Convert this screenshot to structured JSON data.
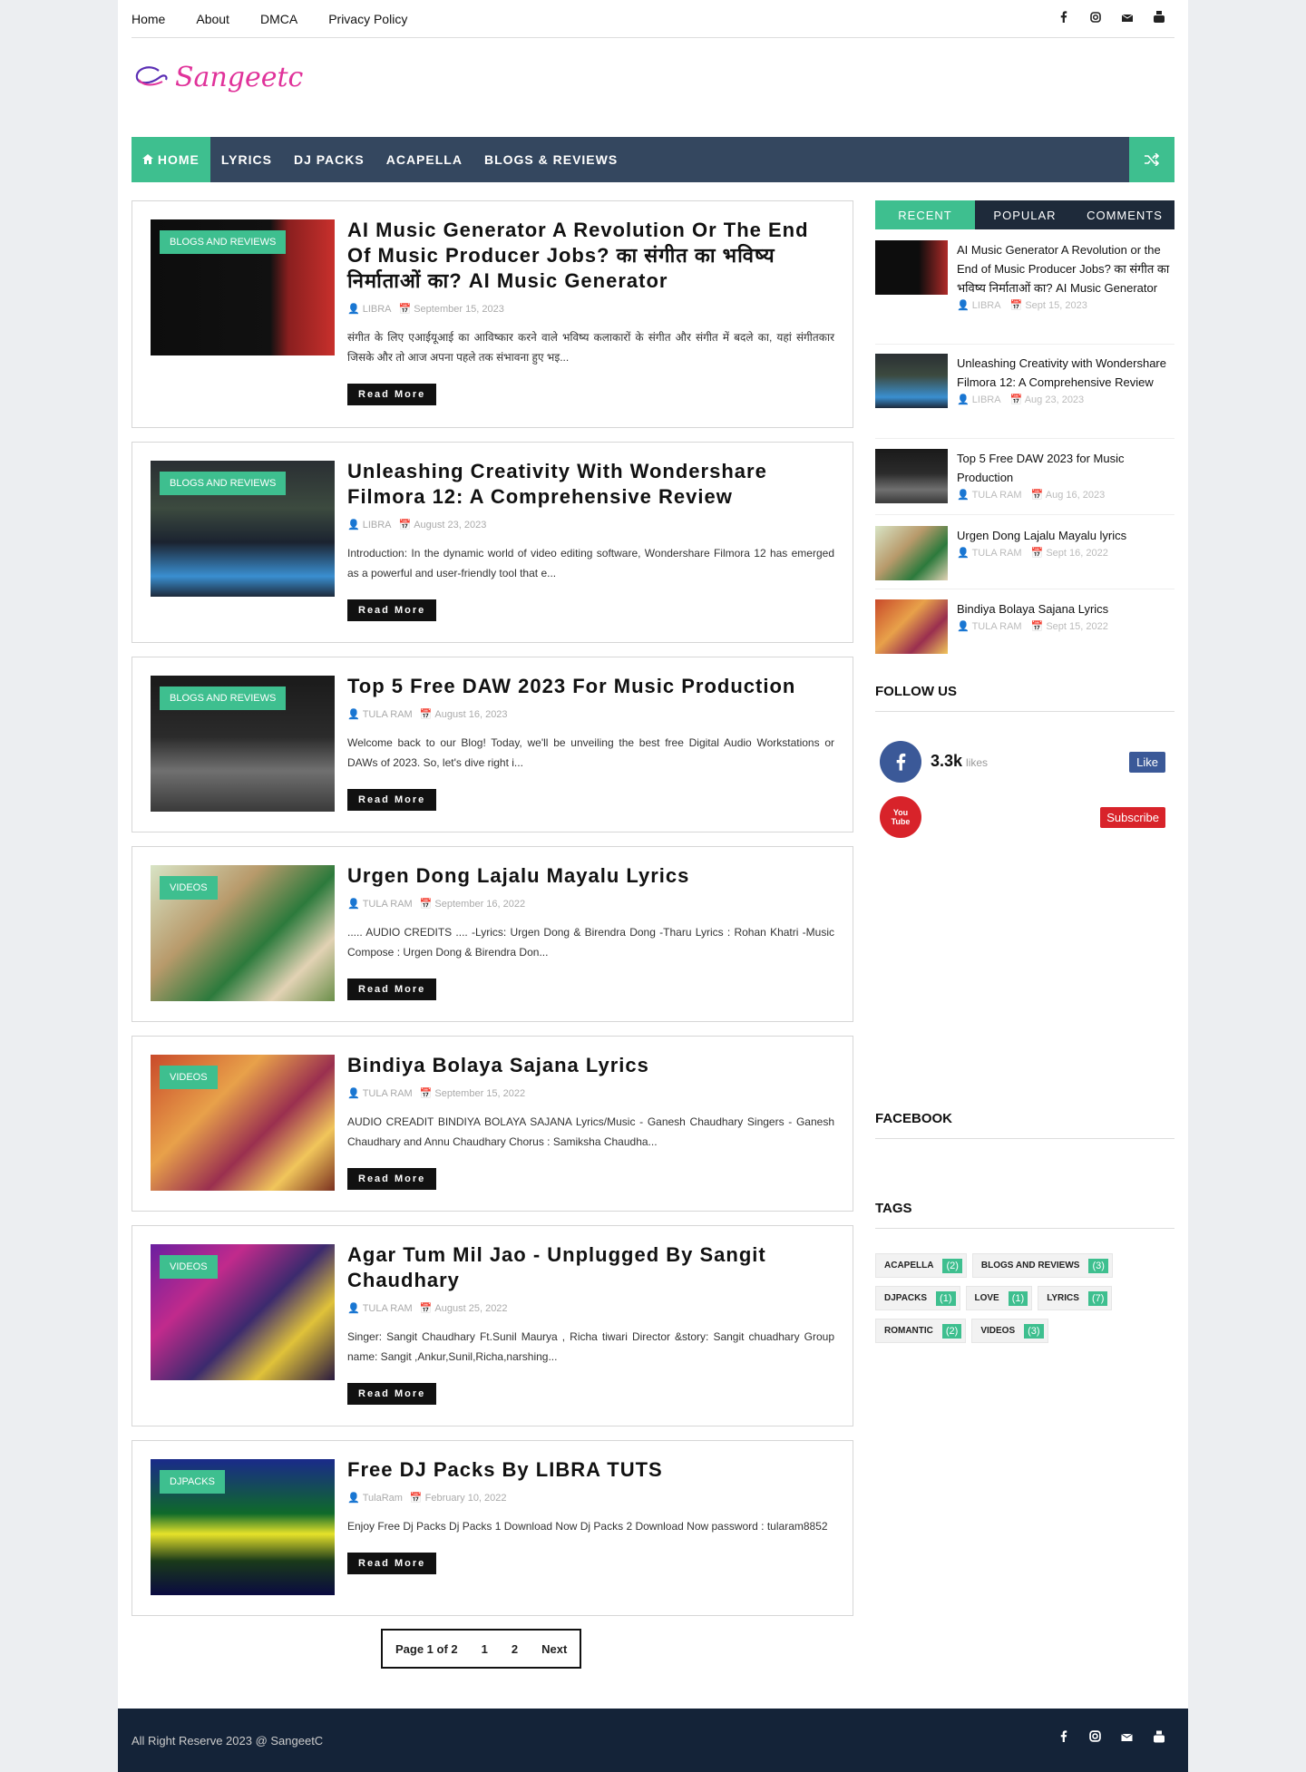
{
  "topnav": [
    "Home",
    "About",
    "DMCA",
    "Privacy Policy"
  ],
  "logo_text": "Sangeetc",
  "mainnav": {
    "home": "HOME",
    "items": [
      "LYRICS",
      "DJ PACKS",
      "ACAPELLA",
      "BLOGS & REVIEWS"
    ]
  },
  "posts": [
    {
      "tag": "BLOGS AND REVIEWS",
      "title": "AI Music Generator A Revolution Or The End Of Music Producer Jobs? का संगीत का भविष्य निर्माताओं का? AI Music Generator",
      "author": "LIBRA",
      "date": "September 15, 2023",
      "excerpt": "संगीत के लिए एआईयूआई का आविष्कार करने वाले भविष्य कलाकारों के संगीत और संगीत में बदले का, यहां संगीतकार जिसके और तो आज अपना पहले तक संभावना हुए भइ...",
      "more": "Read More"
    },
    {
      "tag": "BLOGS AND REVIEWS",
      "title": "Unleashing Creativity With Wondershare Filmora 12: A Comprehensive Review",
      "author": "LIBRA",
      "date": "August 23, 2023",
      "excerpt": "Introduction: In the dynamic world of video editing software, Wondershare Filmora 12 has emerged as a powerful and user-friendly tool that e...",
      "more": "Read More"
    },
    {
      "tag": "BLOGS AND REVIEWS",
      "title": "Top 5 Free DAW 2023 For Music Production",
      "author": "TULA RAM",
      "date": "August 16, 2023",
      "excerpt": "Welcome back to our Blog! Today, we'll be unveiling the best free Digital Audio Workstations or DAWs of 2023. So, let's dive right i...",
      "more": "Read More"
    },
    {
      "tag": "VIDEOS",
      "title": "Urgen Dong Lajalu Mayalu Lyrics",
      "author": "TULA RAM",
      "date": "September 16, 2022",
      "excerpt": "..... AUDIO CREDITS .... -Lyrics: Urgen Dong & Birendra Dong -Tharu Lyrics : Rohan Khatri -Music Compose : Urgen Dong & Birendra Don...",
      "more": "Read More"
    },
    {
      "tag": "VIDEOS",
      "title": "Bindiya Bolaya Sajana Lyrics",
      "author": "TULA RAM",
      "date": "September 15, 2022",
      "excerpt": "AUDIO CREADIT BINDIYA BOLAYA SAJANA Lyrics/Music - Ganesh Chaudhary Singers - Ganesh Chaudhary and Annu Chaudhary Chorus : Samiksha Chaudha...",
      "more": "Read More"
    },
    {
      "tag": "VIDEOS",
      "title": "Agar Tum Mil Jao - Unplugged By Sangit Chaudhary",
      "author": "TULA RAM",
      "date": "August 25, 2022",
      "excerpt": "Singer: Sangit Chaudhary Ft.Sunil Maurya , Richa tiwari Director &story: Sangit chuadhary Group name: Sangit ,Ankur,Sunil,Richa,narshing...",
      "more": "Read More"
    },
    {
      "tag": "DJPACKS",
      "title": "Free DJ Packs By LIBRA TUTS",
      "author": "TulaRam",
      "date": "February 10, 2022",
      "excerpt": "Enjoy Free Dj Packs Dj Packs 1 Download Now Dj Packs 2 Download Now password : tularam8852",
      "more": "Read More"
    }
  ],
  "pager": {
    "label": "Page 1 of 2",
    "p1": "1",
    "p2": "2",
    "next": "Next"
  },
  "sidebar": {
    "tabs": [
      "RECENT",
      "POPULAR",
      "COMMENTS"
    ],
    "recent": [
      {
        "title": "AI Music Generator A Revolution or the End of Music Producer Jobs? का संगीत का भविष्य निर्माताओं का? AI Music Generator",
        "author": "LIBRA",
        "date": "Sept 15, 2023"
      },
      {
        "title": "Unleashing Creativity with Wondershare Filmora 12: A Comprehensive Review",
        "author": "LIBRA",
        "date": "Aug 23, 2023"
      },
      {
        "title": "Top 5 Free DAW 2023 for Music Production",
        "author": "TULA RAM",
        "date": "Aug 16, 2023"
      },
      {
        "title": "Urgen Dong Lajalu Mayalu lyrics",
        "author": "TULA RAM",
        "date": "Sept 16, 2022"
      },
      {
        "title": "Bindiya Bolaya Sajana Lyrics",
        "author": "TULA RAM",
        "date": "Sept 15, 2022"
      }
    ],
    "follow_title": "FOLLOW US",
    "fb_count": "3.3k",
    "fb_unit": "likes",
    "like_btn": "Like",
    "yt_label": "You Tube",
    "subscribe_btn": "Subscribe",
    "facebook_title": "FACEBOOK",
    "tags_title": "TAGS",
    "tags": [
      {
        "name": "ACAPELLA",
        "count": "(2)"
      },
      {
        "name": "BLOGS AND REVIEWS",
        "count": "(3)"
      },
      {
        "name": "DJPACKS",
        "count": "(1)"
      },
      {
        "name": "LOVE",
        "count": "(1)"
      },
      {
        "name": "LYRICS",
        "count": "(7)"
      },
      {
        "name": "ROMANTIC",
        "count": "(2)"
      },
      {
        "name": "VIDEOS",
        "count": "(3)"
      }
    ]
  },
  "footer": {
    "copy": "All Right Reserve 2023 @ SangeetC"
  },
  "colors": {
    "accent": "#3ebf8f",
    "nav": "#34475f",
    "footer": "#142338"
  }
}
